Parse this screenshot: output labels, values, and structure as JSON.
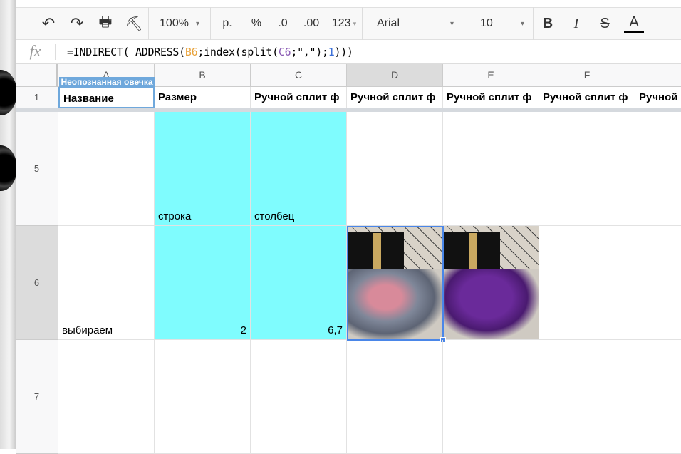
{
  "toolbar": {
    "zoom": "100%",
    "currency": "р.",
    "percent": "%",
    "dec_less": ".0",
    "dec_more": ".00",
    "format": "123",
    "font": "Arial",
    "size": "10",
    "bold": "B",
    "italic": "I",
    "strike": "S",
    "text_color": "A"
  },
  "formula_bar": {
    "fx": "fx",
    "formula_parts": [
      {
        "t": "=INDIRECT( ADDRESS(",
        "c": "#000"
      },
      {
        "t": "B6",
        "c": "#e8a33c"
      },
      {
        "t": ";index(split(",
        "c": "#000"
      },
      {
        "t": "C6",
        "c": "#8a5ab4"
      },
      {
        "t": ";\",\");",
        "c": "#000"
      },
      {
        "t": "1",
        "c": "#3a6fd8"
      },
      {
        "t": ")))",
        "c": "#000"
      }
    ]
  },
  "columns": [
    "A",
    "B",
    "C",
    "D",
    "E",
    "F"
  ],
  "collaborator_tag": "Неопознанная овечка",
  "rows": {
    "r1": {
      "num": "1",
      "cells": [
        "Название",
        "Размер",
        "Ручной сплит ф",
        "Ручной сплит ф",
        "Ручной сплит ф",
        "Ручной сплит ф",
        "Ручной"
      ]
    },
    "r5": {
      "num": "5",
      "b": "строка",
      "c": "столбец"
    },
    "r6": {
      "num": "6",
      "a": "выбираем",
      "b": "2",
      "c": "6,7"
    },
    "r7": {
      "num": "7"
    }
  },
  "colors": {
    "highlight": "#7ffcfe",
    "selection": "#4a86e8",
    "collaborator": "#6fa8dc"
  }
}
